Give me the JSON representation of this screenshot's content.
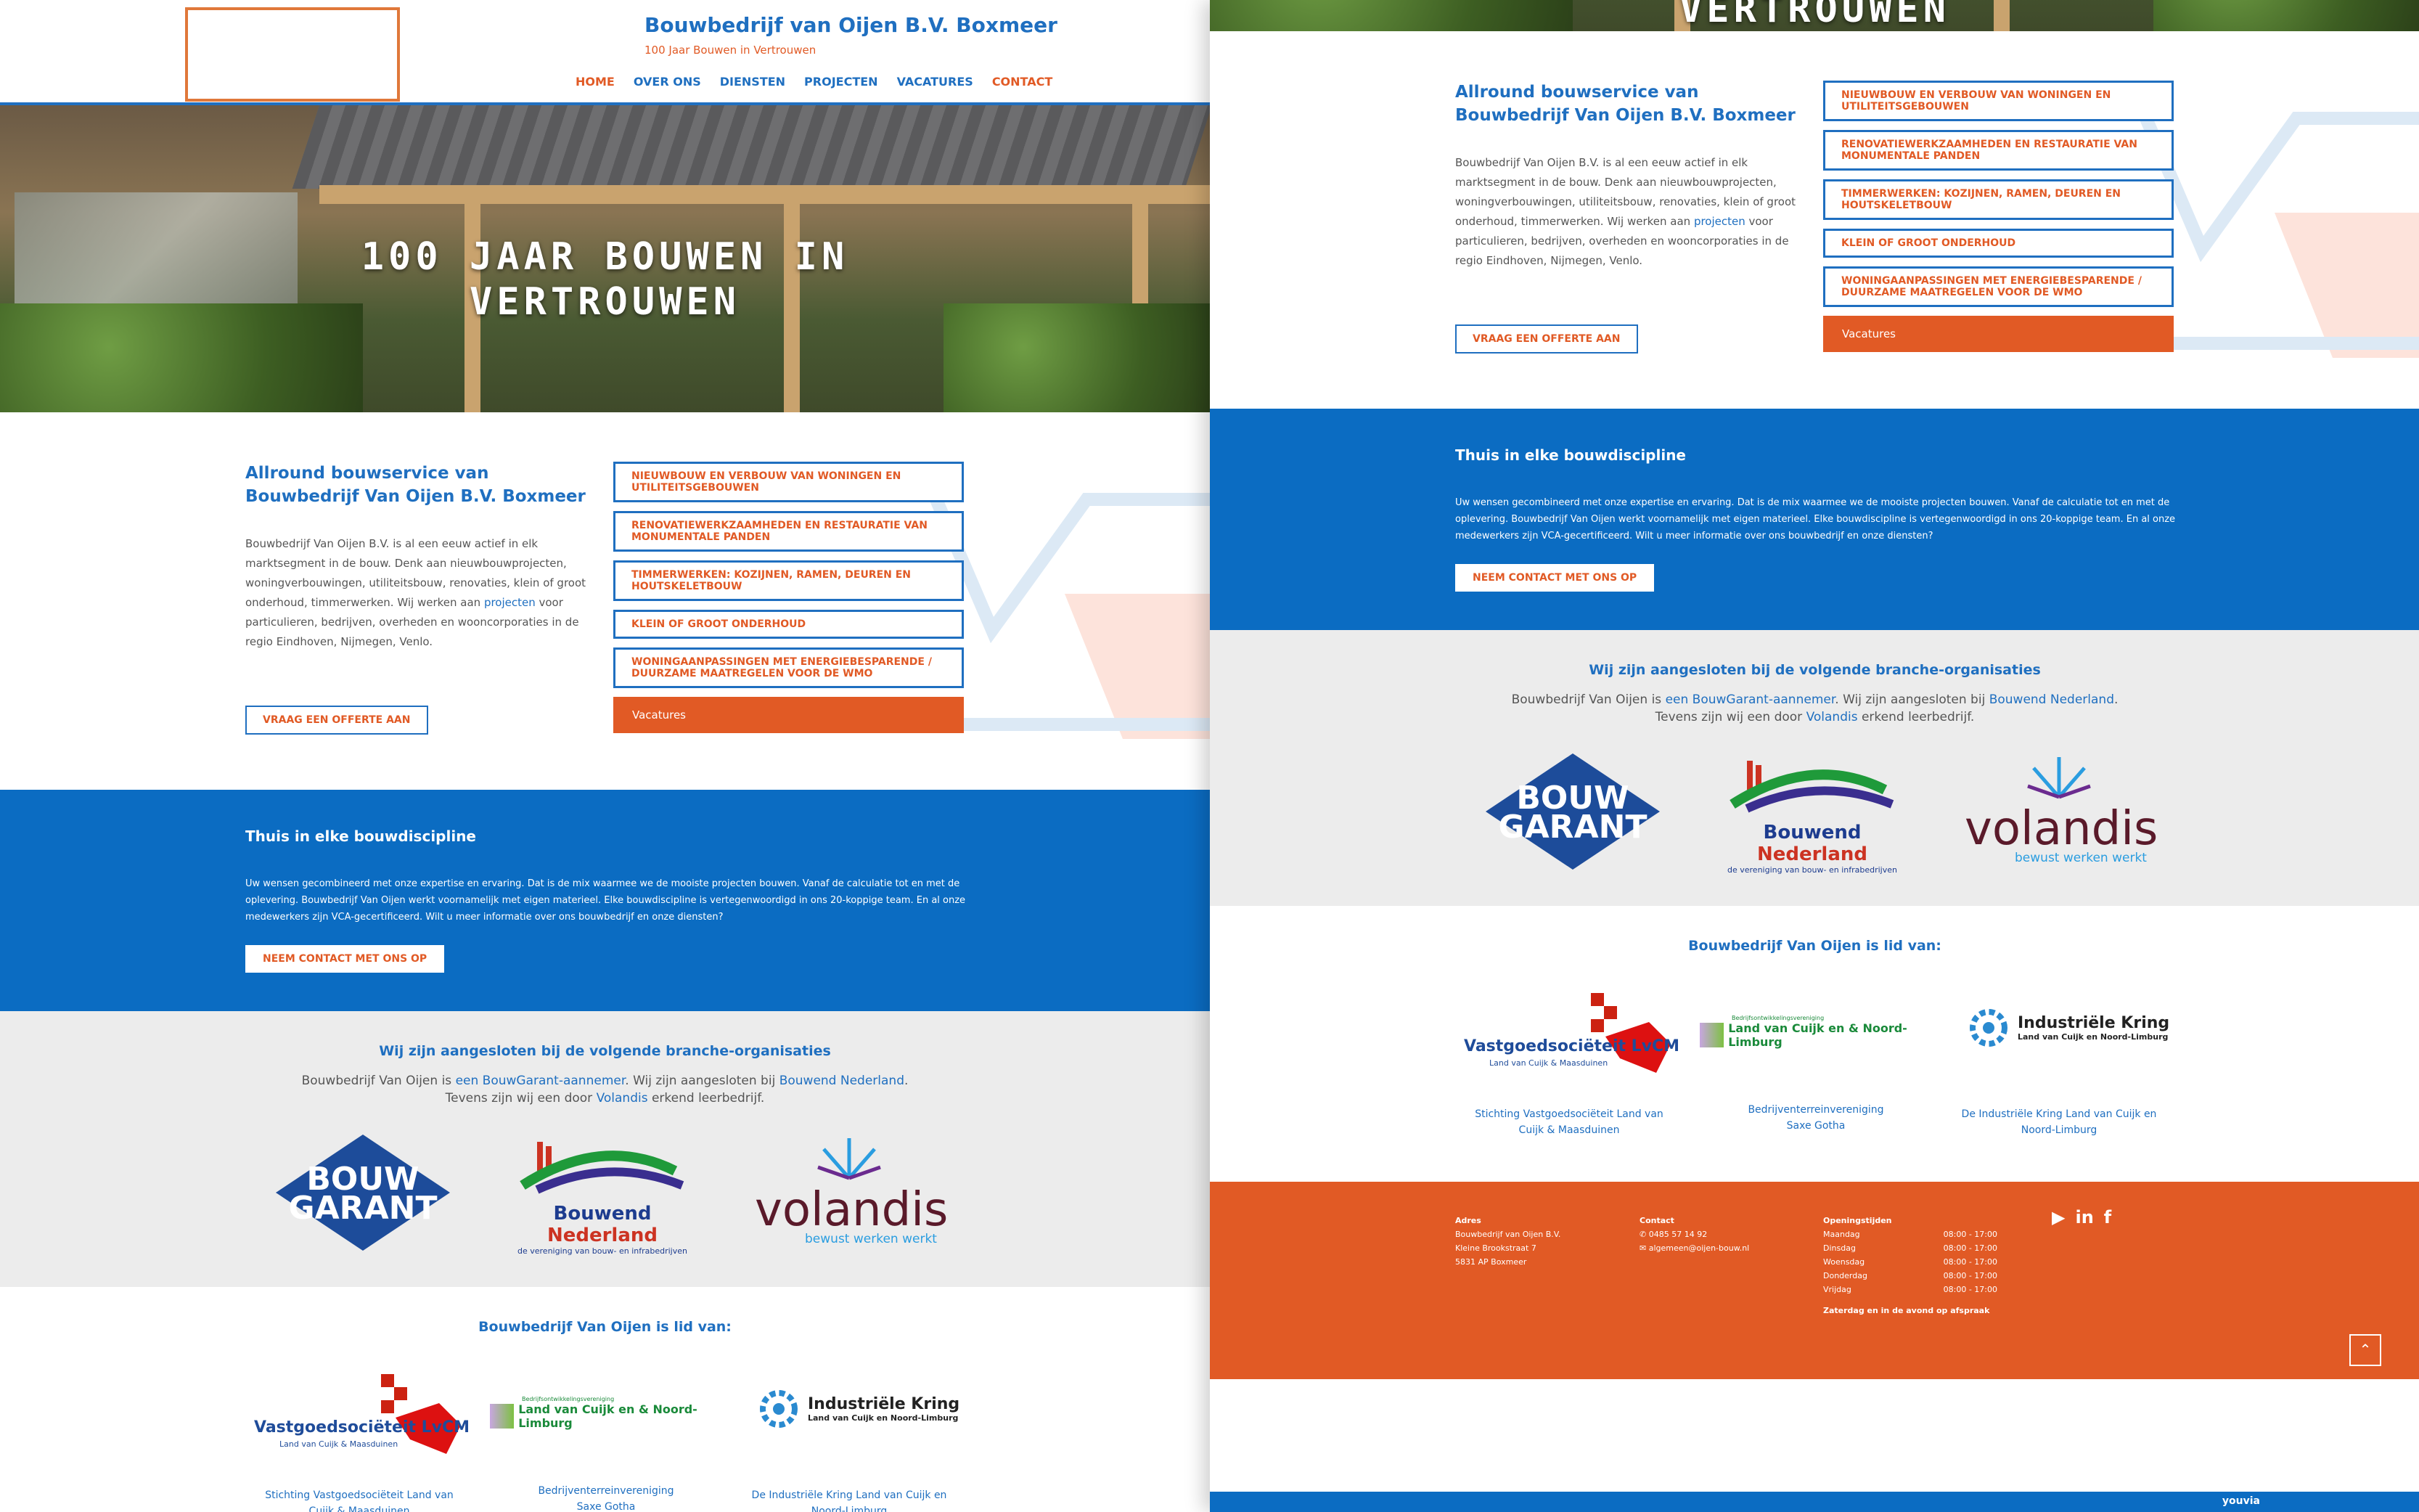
{
  "header": {
    "brand": "Bouwbedrijf van Oijen B.V. Boxmeer",
    "tagline": "100 Jaar Bouwen in Vertrouwen",
    "nav": [
      "HOME",
      "OVER ONS",
      "DIENSTEN",
      "PROJECTEN",
      "VACATURES",
      "CONTACT"
    ]
  },
  "hero": {
    "line1": "100 JAAR BOUWEN IN",
    "line2": "VERTROUWEN"
  },
  "intro": {
    "heading": "Allround bouwservice van Bouwbedrijf Van Oijen B.V. Boxmeer",
    "text_before": "Bouwbedrijf Van Oijen B.V. is al een eeuw actief in elk marktsegment in de bouw. Denk aan nieuwbouwprojecten, woningverbouwingen, utiliteitsbouw, renovaties, klein of groot onderhoud, timmerwerken. Wij werken aan ",
    "text_link": "projecten",
    "text_after": " voor particulieren, bedrijven, overheden en wooncorporaties in de regio Eindhoven, Nijmegen, Venlo.",
    "button": "VRAAG EEN OFFERTE AAN",
    "services": [
      "NIEUWBOUW EN VERBOUW VAN WONINGEN EN UTILITEITSGEBOUWEN",
      "RENOVATIEWERKZAAMHEDEN EN RESTAURATIE VAN MONUMENTALE PANDEN",
      "TIMMERWERKEN: KOZIJNEN, RAMEN, DEUREN EN HOUTSKELETBOUW",
      "KLEIN OF GROOT ONDERHOUD",
      "WONINGAANPASSINGEN MET ENERGIEBESPARENDE / DUURZAME MAATREGELEN VOOR DE WMO"
    ],
    "vacatures": "Vacatures"
  },
  "blue": {
    "heading": "Thuis in elke bouwdiscipline",
    "text": "Uw wensen gecombineerd met onze expertise en ervaring. Dat is de mix waarmee we de mooiste projecten bouwen. Vanaf de calculatie tot en met de oplevering. Bouwbedrijf Van Oijen werkt voornamelijk met eigen materieel. Elke bouwdiscipline is vertegenwoordigd in ons 20-koppige team. En al onze medewerkers zijn VCA-gecertificeerd. Wilt u meer informatie over ons bouwbedrijf en onze diensten?",
    "button": "NEEM CONTACT MET ONS OP"
  },
  "branche": {
    "heading": "Wij zijn aangesloten bij de volgende branche-organisaties",
    "t1": "Bouwbedrijf Van Oijen is ",
    "l1": "een BouwGarant-aannemer",
    "t2": ". Wij zijn aangesloten bij ",
    "l2": "Bouwend Nederland",
    "t3": ".",
    "t4": "Tevens zijn wij een door ",
    "l3": "Volandis",
    "t5": " erkend leerbedrijf.",
    "logos": {
      "bouwgarant": [
        "BOUW",
        "GARANT"
      ],
      "bouwend_a": "Bouwend ",
      "bouwend_b": "Nederland",
      "bouwend_sub": "de vereniging van bouw- en infrabedrijven",
      "volandis": "volandis",
      "volandis_sub": "bewust werken werkt"
    }
  },
  "members": {
    "heading": "Bouwbedrijf Van Oijen is lid van:",
    "lvcm": "Vastgoedsociëteit LvCM",
    "lvcm_sub": "Land van Cuijk & Maasduinen",
    "lvc": "Land van Cuijk en & Noord-Limburg",
    "lvc_top": "Bedrijfsontwikkelingsvereniging",
    "ik": "Industriële Kring",
    "ik_sub": "Land van Cuijk en Noord-Limburg",
    "cap1": "Stichting Vastgoedsociëteit Land van Cuijk & Maasduinen",
    "cap2a": "Bedrijventerreinvereniging",
    "cap2b": "Saxe Gotha",
    "cap3": "De Industriële Kring Land van Cuijk en Noord-Limburg"
  },
  "footer": {
    "adres_h": "Adres",
    "adres": [
      "Bouwbedrijf van Oijen B.V.",
      "Kleine Brookstraat 7",
      "5831 AP Boxmeer"
    ],
    "contact_h": "Contact",
    "phone": "0485 57 14 92",
    "email": "algemeen@oijen-bouw.nl",
    "open_h": "Openingstijden",
    "days": [
      "Maandag",
      "Dinsdag",
      "Woensdag",
      "Donderdag",
      "Vrijdag"
    ],
    "hours": [
      "08:00 - 17:00",
      "08:00 - 17:00",
      "08:00 - 17:00",
      "08:00 - 17:00",
      "08:00 - 17:00"
    ],
    "note": "Zaterdag en in de avond op afspraak",
    "credit": "youvia"
  },
  "colors": {
    "blue": "#0b6cc2",
    "orange": "#e15a25"
  }
}
